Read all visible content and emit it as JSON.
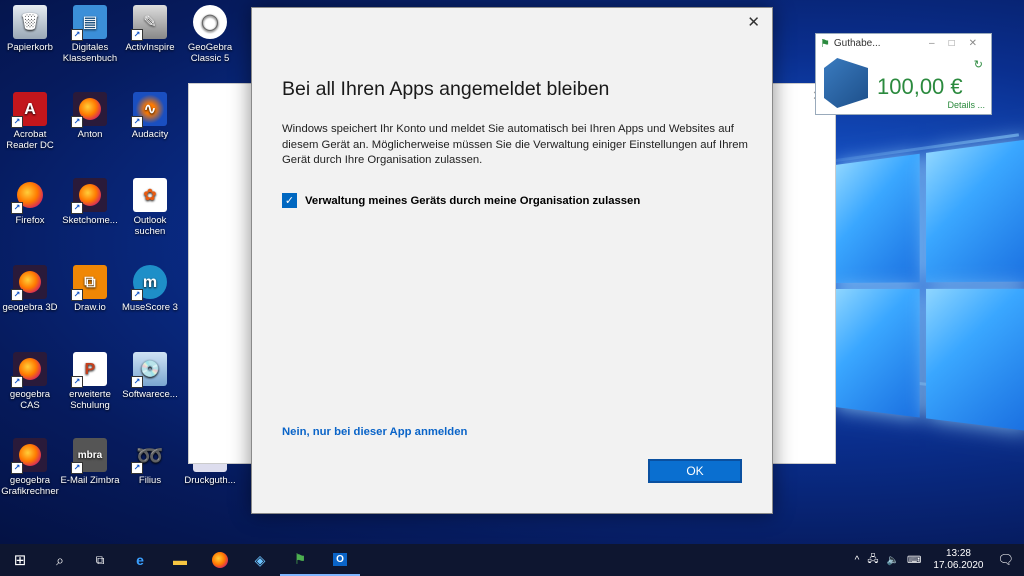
{
  "desktop": {
    "icons": [
      {
        "label": "Papierkorb"
      },
      {
        "label": "Digitales Klassenbuch"
      },
      {
        "label": "ActivInspire"
      },
      {
        "label": "GeoGebra Classic 5"
      },
      {
        "label": "Acrobat Reader DC"
      },
      {
        "label": "Anton"
      },
      {
        "label": "Audacity"
      },
      {
        "label": "Firefox"
      },
      {
        "label": "Sketchome..."
      },
      {
        "label": "Outlook suchen"
      },
      {
        "label": "geogebra 3D"
      },
      {
        "label": "Draw.io"
      },
      {
        "label": "MuseScore 3"
      },
      {
        "label": "geogebra CAS"
      },
      {
        "label": "erweiterte Schulung"
      },
      {
        "label": "Softwarece..."
      },
      {
        "label": "geogebra Grafikrechner"
      },
      {
        "label": "E-Mail Zimbra"
      },
      {
        "label": "Filius"
      },
      {
        "label": "Druckguth..."
      }
    ]
  },
  "widget": {
    "title": "Guthabe...",
    "amount": "100,00 €",
    "details": "Details ..."
  },
  "dialog": {
    "title": "Bei all Ihren Apps angemeldet bleiben",
    "description": "Windows speichert Ihr Konto und meldet Sie automatisch bei Ihren Apps und Websites auf diesem Gerät an. Möglicherweise müssen Sie die Verwaltung einiger Einstellungen auf Ihrem Gerät durch Ihre Organisation zulassen.",
    "checkbox_label": "Verwaltung meines Geräts durch meine Organisation zulassen",
    "checkbox_checked": true,
    "link_label": "Nein, nur bei dieser App anmelden",
    "ok_label": "OK"
  },
  "taskbar": {
    "time": "13:28",
    "date": "17.06.2020"
  },
  "colors": {
    "accent": "#0a6fd0",
    "link": "#0a64c8",
    "widget_green": "#2b8a3e",
    "taskbar": "#0e1630"
  }
}
